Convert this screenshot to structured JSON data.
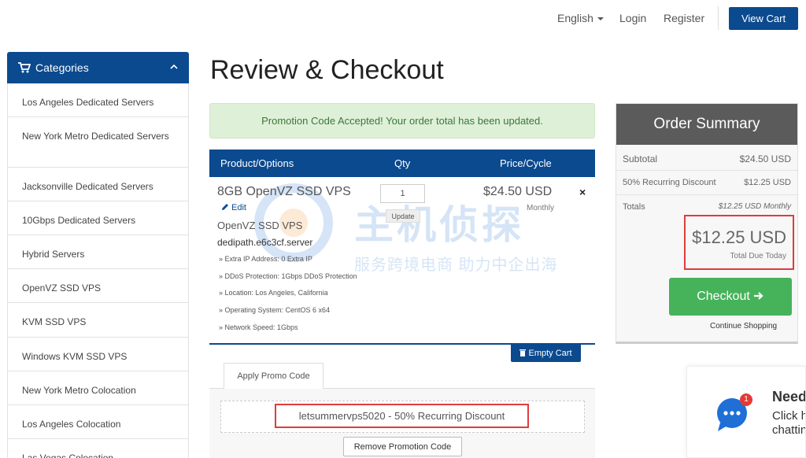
{
  "nav": {
    "language": "English",
    "login": "Login",
    "register": "Register",
    "view_cart": "View Cart"
  },
  "sidebar": {
    "title": "Categories",
    "items": [
      "Los Angeles Dedicated Servers",
      "New York Metro Dedicated Servers",
      "Jacksonville Dedicated Servers",
      "10Gbps Dedicated Servers",
      "Hybrid Servers",
      "OpenVZ SSD VPS",
      "KVM SSD VPS",
      "Windows KVM SSD VPS",
      "New York Metro Colocation",
      "Los Angeles Colocation",
      "Las Vegas Colocation"
    ]
  },
  "page": {
    "title": "Review & Checkout",
    "alert": "Promotion Code Accepted! Your order total has been updated."
  },
  "cart": {
    "headers": {
      "product": "Product/Options",
      "qty": "Qty",
      "price": "Price/Cycle"
    },
    "item": {
      "name": "8GB OpenVZ SSD VPS",
      "edit": "Edit",
      "group": "OpenVZ SSD VPS",
      "domain": "dedipath.e6c3cf.server",
      "qty": "1",
      "update": "Update",
      "price": "$24.50 USD",
      "cycle": "Monthly",
      "remove": "×",
      "options": [
        "» Extra IP Address: 0 Extra IP",
        "» DDoS Protection: 1Gbps DDoS Protection",
        "» Location: Los Angeles, California",
        "» Operating System: CentOS 6 x64",
        "» Network Speed: 1Gbps"
      ]
    },
    "empty_cart": "Empty Cart"
  },
  "promo": {
    "tab": "Apply Promo Code",
    "code": "letsummervps5020 - 50% Recurring Discount",
    "remove": "Remove Promotion Code"
  },
  "summary": {
    "title": "Order Summary",
    "subtotal_label": "Subtotal",
    "subtotal_value": "$24.50 USD",
    "discount_label": "50% Recurring Discount",
    "discount_value": "$12.25 USD",
    "totals_label": "Totals",
    "totals_value": "$12.25 USD Monthly",
    "total_due": "$12.25 USD",
    "total_due_label": "Total Due Today",
    "checkout": "Checkout",
    "continue": "Continue Shopping"
  },
  "watermark": {
    "big": "主机侦探",
    "small": "服务跨境电商 助力中企出海"
  },
  "chat": {
    "badge": "1",
    "title": "Need help?",
    "line1": "Click here and start",
    "line2": "chatting with us!"
  },
  "colors": {
    "brand": "#0b4a8f",
    "success": "#46b35b",
    "highlight": "#e03c3c"
  }
}
